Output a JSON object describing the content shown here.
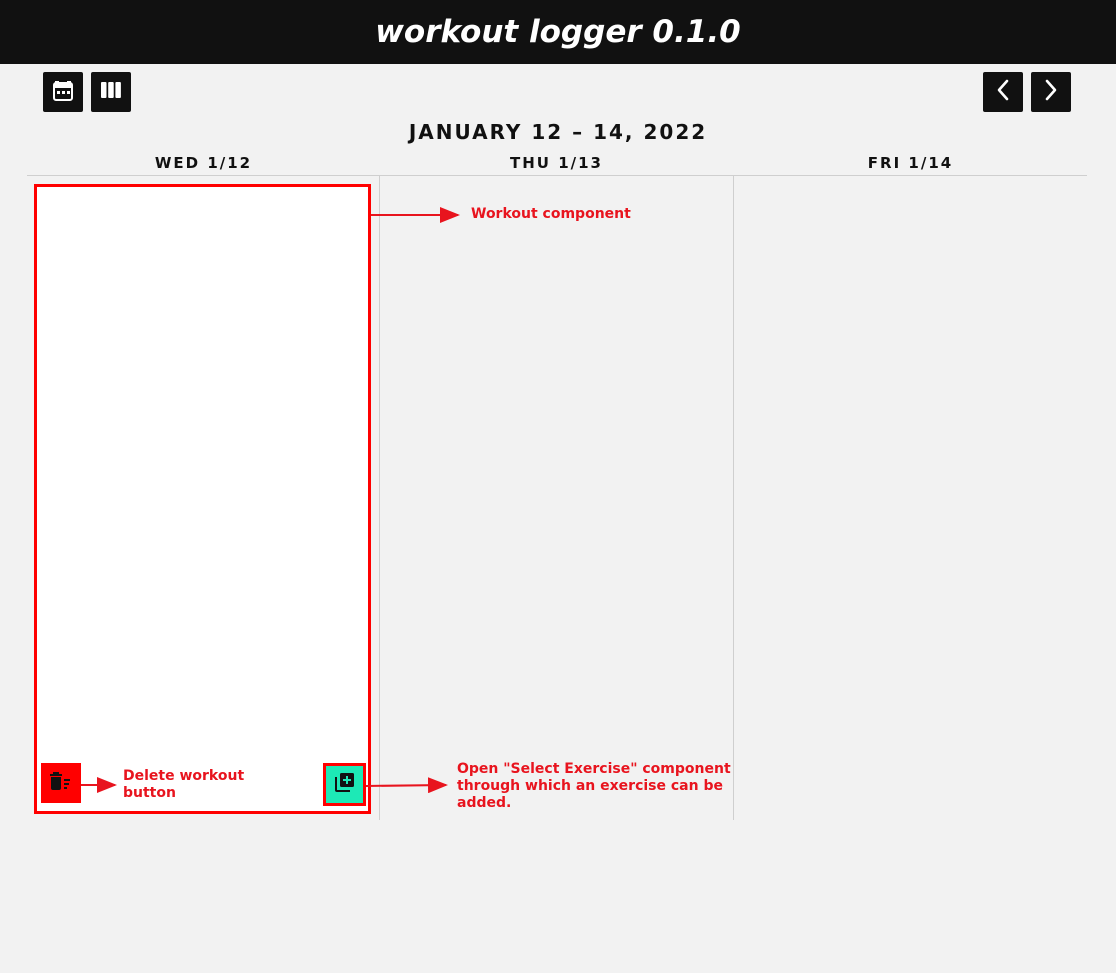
{
  "header": {
    "title": "workout logger 0.1.0"
  },
  "toolbar": {
    "left_buttons": [
      {
        "icon": "calendar-icon"
      },
      {
        "icon": "columns-icon"
      }
    ],
    "right_buttons": [
      {
        "icon": "chevron-left-icon"
      },
      {
        "icon": "chevron-right-icon"
      }
    ]
  },
  "calendar": {
    "range_title": "JANUARY 12 – 14, 2022",
    "days": [
      {
        "label": "WED 1/12"
      },
      {
        "label": "THU 1/13"
      },
      {
        "label": "FRI 1/14"
      }
    ]
  },
  "workout": {
    "delete_icon": "delete-sweep-icon",
    "add_icon": "library-add-icon"
  },
  "annotations": {
    "workout_component": "Workout component",
    "delete_button": [
      "Delete workout",
      "button"
    ],
    "select_exercise": [
      "Open \"Select Exercise\" component",
      "through which an exercise can be",
      "added."
    ]
  },
  "colors": {
    "topbar": "#111111",
    "background": "#f2f2f2",
    "delete": "#ff0000",
    "add": "#1de9b6",
    "annotation": "#e8141e"
  }
}
